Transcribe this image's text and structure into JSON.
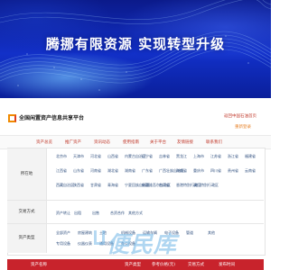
{
  "banner": {
    "slogan": "腾挪有限资源  实现转型升级"
  },
  "header": {
    "site_name": "全国闲置资产信息共享平台",
    "top_link": "返回中国石油首页",
    "login_link": "重新登录"
  },
  "nav": [
    "资产总览",
    "推广资产",
    "资讯动态",
    "使用指南",
    "关于平台",
    "友情链接",
    "联系我们"
  ],
  "filters": {
    "region": {
      "label": "所在地",
      "options": [
        [
          "北京市",
          "天津市",
          "河北省",
          "山西省",
          "内蒙古自治区",
          "辽宁省",
          "吉林省",
          "黑龙江",
          "上海市",
          "江苏省",
          "浙江省",
          "福建省"
        ],
        [
          "江西省",
          "山东省",
          "河南省",
          "湖北省",
          "湖南省",
          "广东省",
          "广西壮族自治区",
          "海南省",
          "重庆市",
          "四川省",
          "贵州省",
          "云南省"
        ],
        [
          "西藏自治区",
          "陕西省",
          "甘肃省",
          "青海省",
          "宁夏回族自治区",
          "新疆维吾尔自治区",
          "台湾省",
          "香港特别行政区",
          "澳门特别行政区"
        ]
      ]
    },
    "method": {
      "label": "交易方式",
      "options": [
        "资产转让",
        "出租",
        "出售",
        "合资合作",
        "其他方式"
      ]
    },
    "type": {
      "label": "资产类型",
      "options": [
        [
          "全部资产",
          "房屋建筑",
          "土地",
          "机械设备",
          "运输车辆",
          "电子设备",
          "管道",
          "其他"
        ],
        [
          "专用设备",
          "仪器仪表",
          "通用设备",
          "办公设备"
        ]
      ]
    }
  },
  "table": {
    "headers": [
      "资产名称",
      "资产类型",
      "参考价格(元)",
      "交易方式",
      "发布时间"
    ]
  },
  "watermark": "便民库"
}
